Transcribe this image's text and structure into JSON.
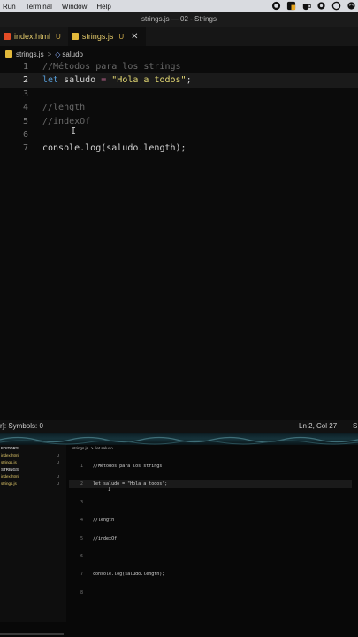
{
  "menubar": {
    "items": [
      "Run",
      "Terminal",
      "Window",
      "Help"
    ],
    "icons": [
      "record-icon",
      "warning-icon",
      "coffee-icon",
      "gear-icon",
      "circle-icon",
      "swirl-icon"
    ]
  },
  "window": {
    "title": "strings.js — 02 - Strings"
  },
  "tabs": [
    {
      "name": "index.html",
      "flag": "U",
      "type": "html"
    },
    {
      "name": "strings.js",
      "flag": "U",
      "type": "js",
      "close": "✕"
    }
  ],
  "breadcrumb": {
    "file": "strings.js",
    "separator": ">",
    "symbol": "saludo"
  },
  "editor": {
    "lines": [
      {
        "num": "1",
        "text": "//Métodos para los strings"
      },
      {
        "num": "2",
        "kw": "let",
        "ident": " saludo ",
        "op": "=",
        "str": " \"Hola a todos\"",
        "end": ";"
      },
      {
        "num": "3",
        "text": ""
      },
      {
        "num": "4",
        "text": "//length"
      },
      {
        "num": "5",
        "text": "//indexOf"
      },
      {
        "num": "6",
        "text": ""
      },
      {
        "num": "7",
        "text": "console.log(saludo.length);"
      }
    ],
    "cursor_glyph": "I"
  },
  "statusbar": {
    "left": "r]: Symbols: 0",
    "position": "Ln 2, Col 27",
    "edge": "S"
  },
  "mini": {
    "sections": {
      "editors": "EDITORS",
      "project": "STRINGS"
    },
    "editors": [
      {
        "name": "index.html",
        "flag": "U"
      },
      {
        "name": "strings.js",
        "flag": "U"
      }
    ],
    "files": [
      {
        "name": "index.html",
        "flag": "U"
      },
      {
        "name": "strings.js",
        "flag": "U"
      }
    ],
    "crumb_file": "strings.js",
    "crumb_sep": ">",
    "crumb_symbol": "let saludo",
    "lines": [
      {
        "num": "1",
        "text": "//Métodos para los strings"
      },
      {
        "num": "2",
        "text": "let saludo = \"Hola a todos\";"
      },
      {
        "num": "3",
        "text": ""
      },
      {
        "num": "4",
        "text": "//length"
      },
      {
        "num": "5",
        "text": "//indexOf"
      },
      {
        "num": "6",
        "text": ""
      },
      {
        "num": "7",
        "text": "console.log(saludo.length);"
      },
      {
        "num": "8",
        "text": ""
      }
    ],
    "cursor_glyph": "I"
  },
  "colors": {
    "keyword": "#569cd6",
    "string": "#e6db74",
    "comment": "#6a6a6a",
    "operator": "#d16d9e",
    "js_badge": "#e2b93b",
    "html_badge": "#e34c26"
  }
}
